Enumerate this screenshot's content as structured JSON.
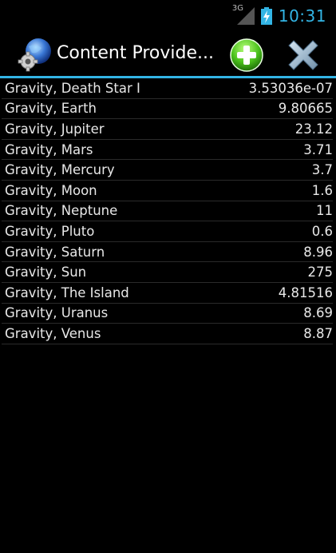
{
  "status_bar": {
    "network": "3G",
    "time": "10:31"
  },
  "action_bar": {
    "title": "Content Provide...",
    "add_icon": "add-icon",
    "close_icon": "close-icon"
  },
  "colors": {
    "accent": "#33b5e5",
    "add_green": "#4cc21c"
  },
  "list": [
    {
      "name": "Gravity, Death Star I",
      "value": "3.53036e-07"
    },
    {
      "name": "Gravity, Earth",
      "value": "9.80665"
    },
    {
      "name": "Gravity, Jupiter",
      "value": "23.12"
    },
    {
      "name": "Gravity, Mars",
      "value": "3.71"
    },
    {
      "name": "Gravity, Mercury",
      "value": "3.7"
    },
    {
      "name": "Gravity, Moon",
      "value": "1.6"
    },
    {
      "name": "Gravity, Neptune",
      "value": "11"
    },
    {
      "name": "Gravity, Pluto",
      "value": "0.6"
    },
    {
      "name": "Gravity, Saturn",
      "value": "8.96"
    },
    {
      "name": "Gravity, Sun",
      "value": "275"
    },
    {
      "name": "Gravity, The Island",
      "value": "4.81516"
    },
    {
      "name": "Gravity, Uranus",
      "value": "8.69"
    },
    {
      "name": "Gravity, Venus",
      "value": "8.87"
    }
  ]
}
